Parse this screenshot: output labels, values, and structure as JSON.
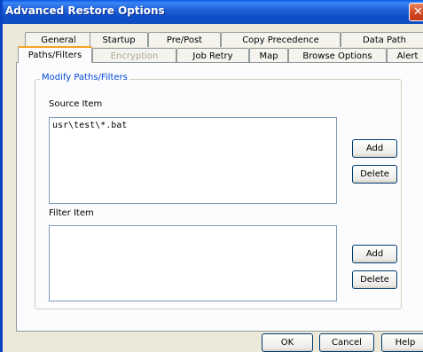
{
  "window": {
    "title": "Advanced Restore Options",
    "close_glyph": "✕"
  },
  "tabs_row1": [
    "General",
    "Startup",
    "Pre/Post",
    "Copy Precedence",
    "Data Path"
  ],
  "tabs_row2": [
    "Paths/Filters",
    "Encryption",
    "Job Retry",
    "Map",
    "Browse Options",
    "Alert"
  ],
  "group": {
    "legend": "Modify Paths/Filters"
  },
  "source": {
    "label": "Source Item",
    "items": [
      "usr\\test\\*.bat"
    ],
    "add_label": "Add",
    "delete_label": "Delete"
  },
  "filter": {
    "label": "Filter Item",
    "items": [],
    "add_label": "Add",
    "delete_label": "Delete"
  },
  "footer": {
    "ok_label": "OK",
    "cancel_label": "Cancel",
    "help_label": "Help"
  }
}
